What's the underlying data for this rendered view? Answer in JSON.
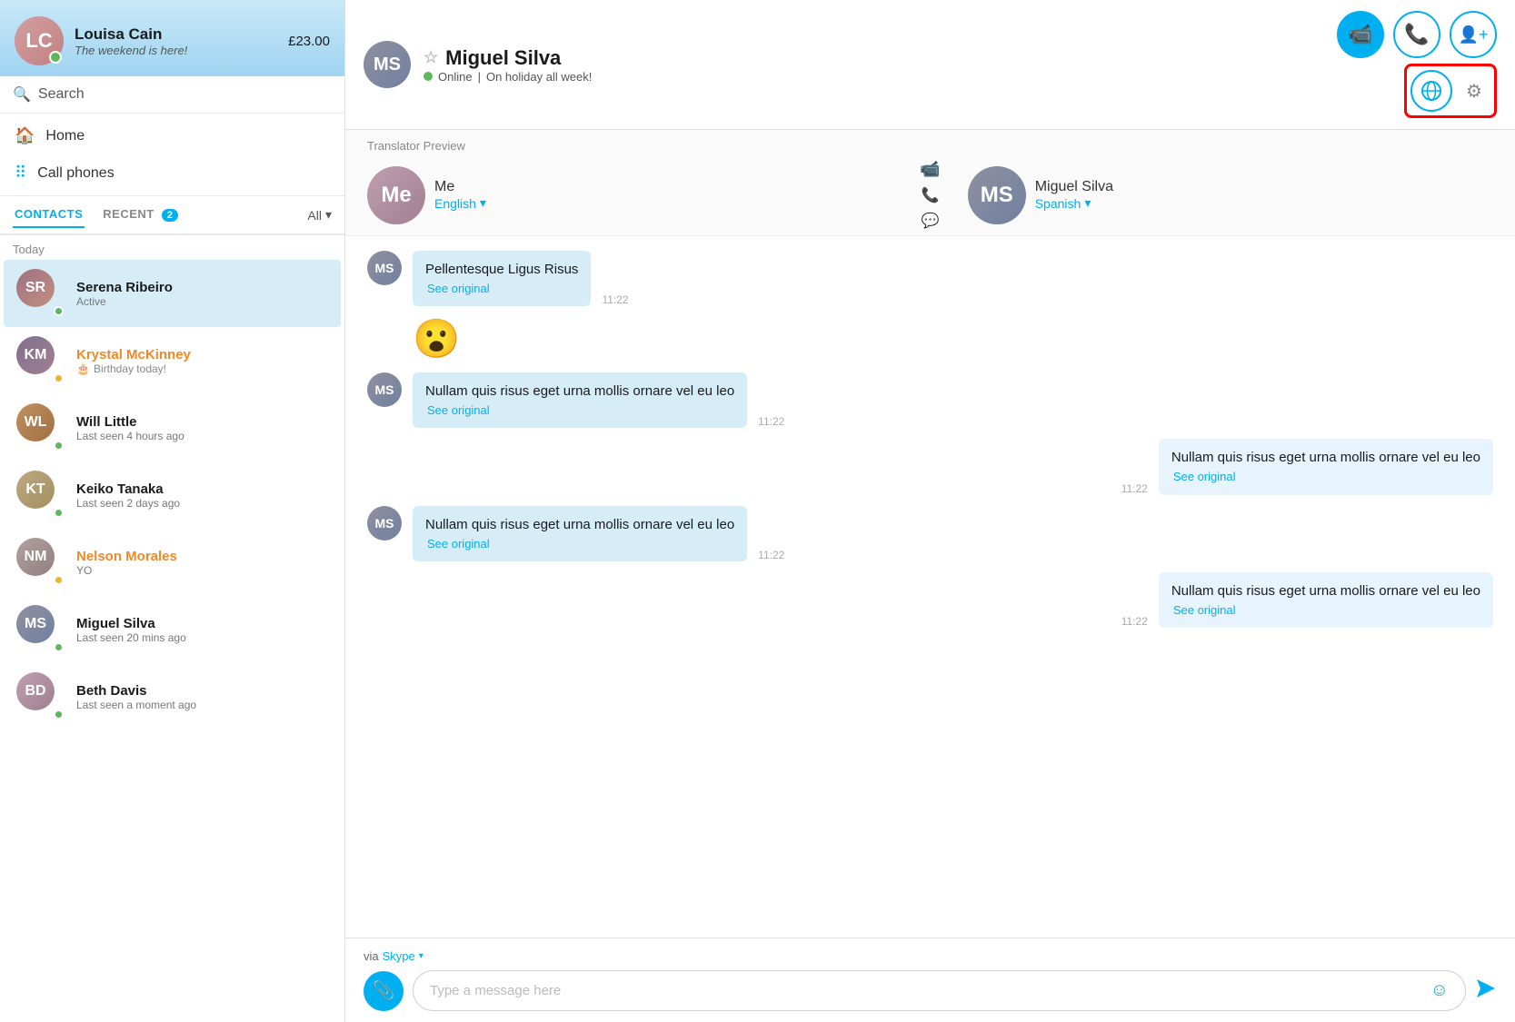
{
  "sidebar": {
    "profile": {
      "name": "Louisa Cain",
      "status": "The weekend is here!",
      "credit": "£23.00"
    },
    "search": {
      "placeholder": "Search"
    },
    "nav": [
      {
        "id": "home",
        "icon": "🏠",
        "label": "Home"
      },
      {
        "id": "call-phones",
        "icon": "⠿",
        "label": "Call phones"
      }
    ],
    "tabs": [
      {
        "id": "contacts",
        "label": "CONTACTS",
        "active": true,
        "badge": null
      },
      {
        "id": "recent",
        "label": "RECENT",
        "active": false,
        "badge": "2"
      }
    ],
    "filter": "All",
    "section_today": "Today",
    "contacts": [
      {
        "id": "serena",
        "name": "Serena Ribeiro",
        "sub": "Active",
        "status": "green",
        "selected": true
      },
      {
        "id": "krystal",
        "name": "Krystal McKinney",
        "sub": "Birthday today!",
        "status": "yellow",
        "nameColor": "orange",
        "birthday": true
      },
      {
        "id": "will",
        "name": "Will Little",
        "sub": "Last seen 4 hours ago",
        "status": "green"
      },
      {
        "id": "keiko",
        "name": "Keiko Tanaka",
        "sub": "Last seen 2 days ago",
        "status": "green"
      },
      {
        "id": "nelson",
        "name": "Nelson Morales",
        "sub": "YO",
        "status": "yellow",
        "nameColor": "orange"
      },
      {
        "id": "miguel",
        "name": "Miguel Silva",
        "sub": "Last seen 20 mins ago",
        "status": "green"
      },
      {
        "id": "beth",
        "name": "Beth Davis",
        "sub": "Last seen a moment ago",
        "status": "green"
      }
    ]
  },
  "chat": {
    "contact_name": "Miguel Silva",
    "contact_status": "Online",
    "contact_note": "On holiday all week!",
    "actions": {
      "video_label": "video-call",
      "audio_label": "audio-call",
      "add_label": "add-contact",
      "translator_label": "translator",
      "settings_label": "settings"
    },
    "translator_preview": {
      "label": "Translator Preview",
      "me": {
        "name": "Me",
        "lang": "English"
      },
      "contact": {
        "name": "Miguel Silva",
        "lang": "Spanish"
      }
    },
    "messages": [
      {
        "id": 1,
        "sender": "contact",
        "text": "Pellentesque Ligus Risus",
        "sub": "See original",
        "time": "11:22"
      },
      {
        "id": 2,
        "sender": "emoji",
        "text": "😮"
      },
      {
        "id": 3,
        "sender": "contact",
        "text": "Nullam quis risus eget urna mollis ornare vel eu leo",
        "sub": "See original",
        "time": "11:22"
      },
      {
        "id": 4,
        "sender": "me",
        "text": "Nullam quis risus eget urna mollis ornare vel eu leo",
        "sub": "See original",
        "time": "11:22"
      },
      {
        "id": 5,
        "sender": "contact",
        "text": "Nullam quis risus eget urna mollis ornare vel eu leo",
        "sub": "See original",
        "time": "11:22"
      },
      {
        "id": 6,
        "sender": "me",
        "text": "Nullam quis risus eget urna mollis ornare vel eu leo",
        "sub": "See original",
        "time": "11:22"
      }
    ],
    "input": {
      "placeholder": "Type a message here",
      "via_label": "via",
      "via_service": "Skype"
    }
  }
}
